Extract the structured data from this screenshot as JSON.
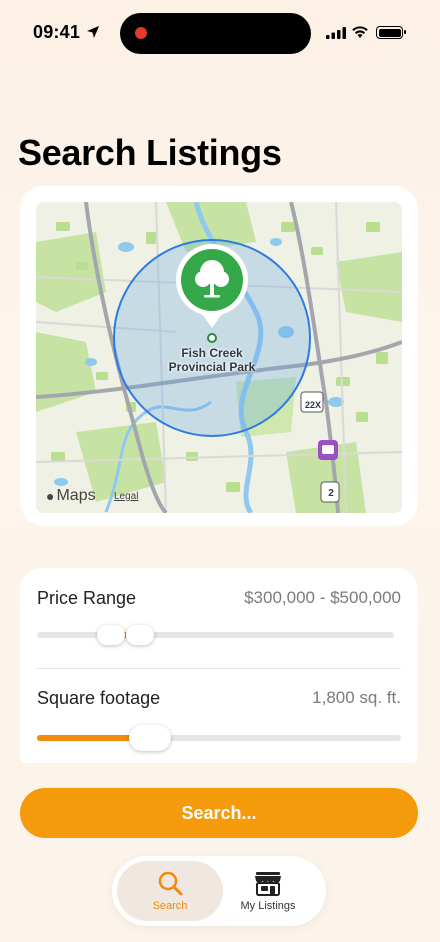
{
  "status": {
    "time": "09:41"
  },
  "title": "Search Listings",
  "map": {
    "place_label_line1": "Fish Creek",
    "place_label_line2": "Provincial Park",
    "attribution": "Maps",
    "legal": "Legal",
    "route_22x": "22X",
    "route_2": "2",
    "pin_icon": "tree-icon"
  },
  "filters": {
    "price": {
      "label": "Price Range",
      "value": "$300,000 - $500,000"
    },
    "sqft": {
      "label": "Square footage",
      "value": "1,800 sq. ft."
    }
  },
  "search_button": "Search...",
  "tabs": [
    {
      "label": "Search",
      "icon": "magnifier-icon",
      "active": true
    },
    {
      "label": "My Listings",
      "icon": "storefront-icon",
      "active": false
    }
  ],
  "colors": {
    "accent": "#f59a0a",
    "background": "#fdf3ea"
  }
}
